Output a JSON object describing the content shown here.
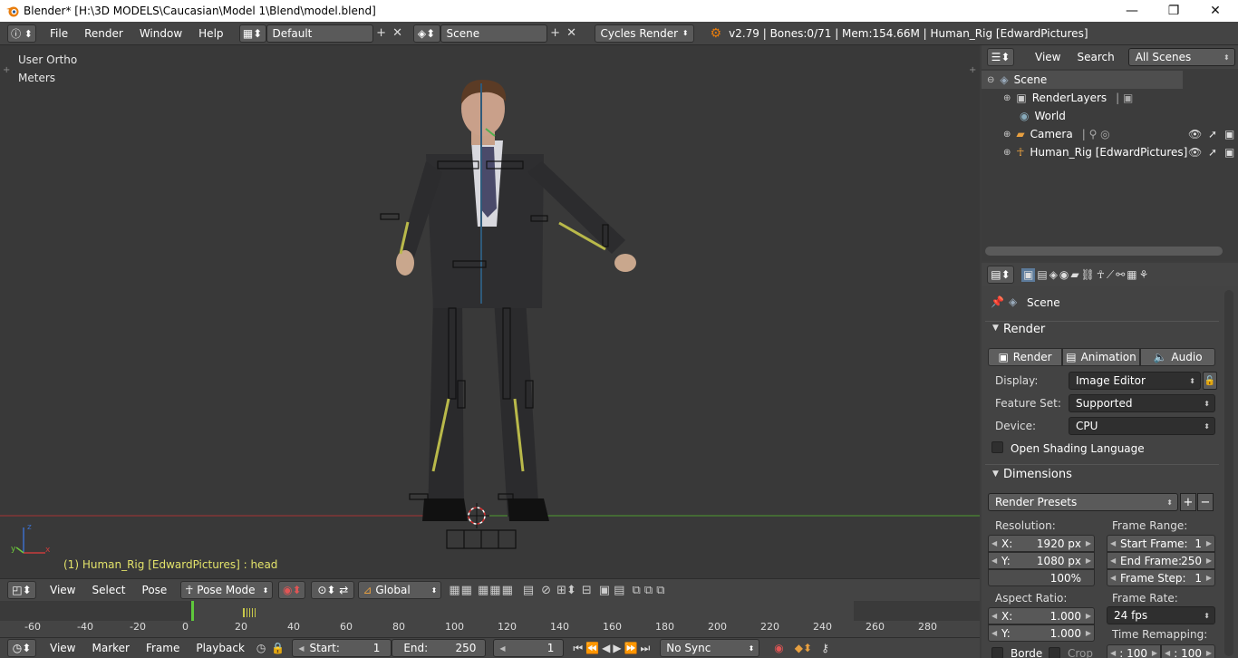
{
  "window": {
    "title": "Blender* [H:\\3D MODELS\\Caucasian\\Model 1\\Blend\\model.blend]",
    "minimize": "—",
    "restore": "❐",
    "close": "✕"
  },
  "header": {
    "menus": [
      "File",
      "Render",
      "Window",
      "Help"
    ],
    "screen_layout": "Default",
    "scene": "Scene",
    "render_engine": "Cycles Render",
    "stats": "v2.79 | Bones:0/71 | Mem:154.66M | Human_Rig [EdwardPictures]"
  },
  "viewport": {
    "view_name": "User Ortho",
    "units": "Meters",
    "status": "(1) Human_Rig [EdwardPictures] : head"
  },
  "viewport_header": {
    "menus": [
      "View",
      "Select",
      "Pose"
    ],
    "mode": "Pose Mode",
    "orientation": "Global"
  },
  "outliner": {
    "menus": [
      "View",
      "Search"
    ],
    "filter": "All Scenes",
    "items": [
      {
        "label": "Scene"
      },
      {
        "label": "RenderLayers"
      },
      {
        "label": "World"
      },
      {
        "label": "Camera"
      },
      {
        "label": "Human_Rig [EdwardPictures]"
      }
    ]
  },
  "properties": {
    "context": "Scene",
    "render_panel": {
      "title": "Render",
      "buttons": [
        "Render",
        "Animation",
        "Audio"
      ],
      "display_label": "Display:",
      "display_value": "Image Editor",
      "feature_set_label": "Feature Set:",
      "feature_set_value": "Supported",
      "device_label": "Device:",
      "device_value": "CPU",
      "osl_label": "Open Shading Language"
    },
    "dimensions_panel": {
      "title": "Dimensions",
      "presets": "Render Presets",
      "resolution_label": "Resolution:",
      "res_x_label": "X:",
      "res_x": "1920 px",
      "res_y_label": "Y:",
      "res_y": "1080 px",
      "res_pct": "100%",
      "frame_range_label": "Frame Range:",
      "start_frame_label": "Start Frame:",
      "start_frame": "1",
      "end_frame_label": "End Frame:",
      "end_frame": "250",
      "frame_step_label": "Frame Step:",
      "frame_step": "1",
      "aspect_label": "Aspect Ratio:",
      "aspect_x": "1.000",
      "aspect_y": "1.000",
      "frame_rate_label": "Frame Rate:",
      "frame_rate": "24 fps",
      "time_remap_label": "Time Remapping:",
      "time_old": ": 100",
      "time_new": ": 100",
      "border_label": "Borde",
      "crop_label": "Crop"
    }
  },
  "timeline": {
    "ticks": [
      "-60",
      "-40",
      "-20",
      "0",
      "20",
      "40",
      "60",
      "80",
      "100",
      "120",
      "140",
      "160",
      "180",
      "200",
      "220",
      "240",
      "260",
      "280"
    ],
    "menus": [
      "View",
      "Marker",
      "Frame",
      "Playback"
    ],
    "start_label": "Start:",
    "start": "1",
    "end_label": "End:",
    "end": "250",
    "current_frame": "1",
    "sync": "No Sync"
  },
  "colors": {
    "accent_orange": "#e87d0d",
    "status_yellow": "#e3e36a",
    "x_axis": "#c83c3c",
    "y_axis": "#6ec83c",
    "z_axis": "#3c6ec8"
  }
}
